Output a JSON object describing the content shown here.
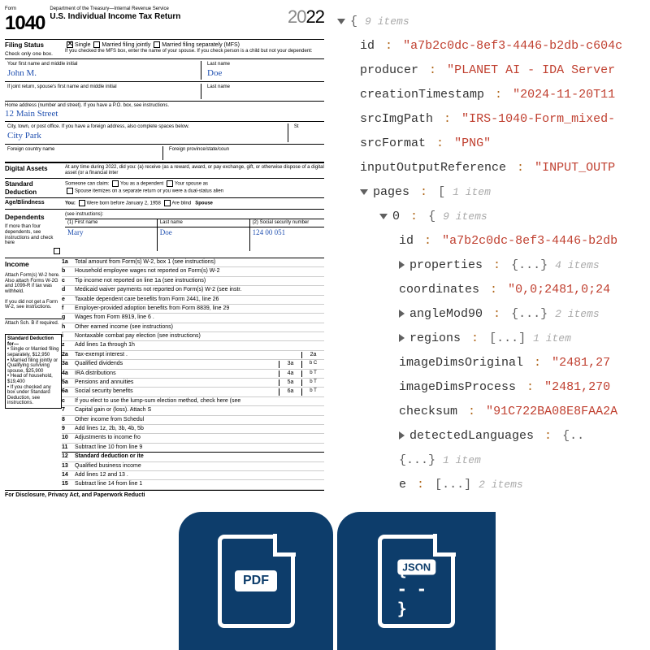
{
  "form": {
    "number_prefix": "Form",
    "number": "1040",
    "dept": "Department of the Treasury—Internal Revenue Service",
    "title": "U.S. Individual Income Tax Return",
    "year_20": "20",
    "year_yy": "22",
    "filing_status_label": "Filing Status",
    "filing_status_sub": "Check only one box.",
    "fs_single": "Single",
    "fs_mfj": "Married filing jointly",
    "fs_mfs": "Married filing separately (MFS)",
    "fs_note": "If you checked the MFS box, enter the name of your spouse. If you check person is a child but not your dependent:",
    "name_first_lbl": "Your first name and middle initial",
    "name_first_val": "John M.",
    "name_last_lbl": "Last name",
    "name_last_val": "Doe",
    "joint_first_lbl": "If joint return, spouse's first name and middle initial",
    "joint_last_lbl": "Last name",
    "addr_lbl": "Home address (number and street). If you have a P.O. box, see instructions.",
    "addr_val": "12 Main Street",
    "city_lbl": "City, town, or post office. If you have a foreign address, also complete spaces below.",
    "city_val": "City Park",
    "state_lbl": "St",
    "foreign_lbl": "Foreign country name",
    "foreign_prov_lbl": "Foreign province/state/coun",
    "digital_lbl": "Digital Assets",
    "digital_txt": "At any time during 2022, did you: (a) receive (as a reward, award, or pay exchange, gift, or otherwise dispose of a digital asset (or a financial inter",
    "std_lbl": "Standard Deduction",
    "std_txt": "Someone can claim:",
    "std_you_dep": "You as a dependent",
    "std_sp_dep": "Your spouse as",
    "std_sep": "Spouse itemizes on a separate return or you were a dual-status alien",
    "age_lbl": "Age/Blindness",
    "age_you": "You:",
    "age_born": "Were born before January 2, 1958",
    "age_blind": "Are blind",
    "age_spouse": "Spouse",
    "dep_lbl": "Dependents",
    "dep_see": "(see instructions):",
    "dep_more": "If more than four dependents, see instructions and check here",
    "dep_first_hdr": "(1) First name",
    "dep_last_hdr": "Last name",
    "dep_ssn_hdr": "(2) Social security number",
    "dep_first": "Mary",
    "dep_last": "Doe",
    "dep_ssn": "124 00 051",
    "income_lbl": "Income",
    "income_note": "Attach Form(s) W-2 here. Also attach Forms W-2G and 1099-R if tax was withheld.",
    "income_note2": "If you did not get a Form W-2, see instructions.",
    "attach_b": "Attach Sch. B if required.",
    "std_ded_lbl": "Standard Deduction for—",
    "lines": {
      "1a": "Total amount from Form(s) W-2, box 1 (see instructions)",
      "1b": "Household employee wages not reported on Form(s) W-2",
      "1c": "Tip income not reported on line 1a (see instructions)",
      "1d": "Medicaid waiver payments not reported on Form(s) W-2 (see instr.",
      "1e": "Taxable dependent care benefits from Form 2441, line 26",
      "1f": "Employer-provided adoption benefits from Form 8839, line 29",
      "1g": "Wages from Form 8919, line 6 .",
      "1h": "Other earned income (see instructions)",
      "1i": "Nontaxable combat pay election (see instructions)",
      "1z": "Add lines 1a through 1h",
      "2a": "Tax-exempt interest .",
      "3a": "Qualified dividends",
      "4a": "IRA distributions",
      "5a": "Pensions and annuities",
      "6a": "Social security benefits",
      "6c": "If you elect to use the lump-sum election method, check here (see",
      "7": "Capital gain or (loss). Attach S",
      "8": "Other income from Schedul",
      "9": "Add lines 1z, 2b, 3b, 4b, 5b",
      "10": "Adjustments to income fro",
      "11": "Subtract line 10 from line 9",
      "12": "Standard deduction or ite",
      "13": "Qualified business income",
      "14": "Add lines 12 and 13 .",
      "15": "Subtract line 14 from line 1"
    },
    "std_bullets": {
      "b1": "Single or Married filing separately, $12,950",
      "b2": "Married filing jointly or Qualifying surviving spouse, $25,900",
      "b3": "Head of household, $19,400",
      "b4": "If you checked any box under Standard Deduction, see instructions."
    },
    "disclosure": "For Disclosure, Privacy Act, and Paperwork Reducti"
  },
  "json": {
    "root_count": "9 items",
    "id_key": "id",
    "id_val": "\"a7b2c0dc-8ef3-4446-b2db-c604c",
    "producer_key": "producer",
    "producer_val": "\"PLANET AI - IDA Server",
    "ts_key": "creationTimestamp",
    "ts_val": "\"2024-11-20T11",
    "src_key": "srcImgPath",
    "src_val": "\"IRS-1040-Form_mixed-",
    "fmt_key": "srcFormat",
    "fmt_val": "\"PNG\"",
    "ioref_key": "inputOutputReference",
    "ioref_val": "\"INPUT_OUTP",
    "pages_key": "pages",
    "pages_count": "1 item",
    "page0_key": "0",
    "page0_count": "9 items",
    "p_id_val": "\"a7b2c0dc-8ef3-4446-b2db",
    "props_key": "properties",
    "props_count": "4 items",
    "coords_key": "coordinates",
    "coords_val": "\"0,0;2481,0;24",
    "angle_key": "angleMod90",
    "angle_count": "2 items",
    "regions_key": "regions",
    "regions_count": "1 item",
    "dims_orig_key": "imageDimsOriginal",
    "dims_orig_val": "\"2481,27",
    "dims_proc_key": "imageDimsProcess",
    "dims_proc_val": "\"2481,270",
    "checksum_key": "checksum",
    "checksum_val": "\"91C722BA08E8FAA2A",
    "lang_key": "detectedLanguages",
    "frag1_count": "1 item",
    "frag2_key": "e",
    "frag2_count": "2 items"
  },
  "badges": {
    "pdf": "PDF",
    "json": "JSON",
    "json_braces": "{ - - - }"
  }
}
